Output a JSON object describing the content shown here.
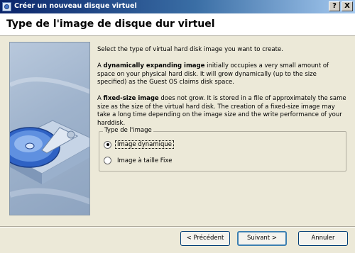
{
  "window": {
    "title": "Créer un nouveau disque virtuel",
    "help_label": "?",
    "close_label": "X"
  },
  "header": {
    "title": "Type de l'image de disque dur virtuel"
  },
  "content": {
    "intro": "Select the type of virtual hard disk image you want to create.",
    "dynamic_bold": "dynamically expanding image",
    "dynamic_prefix": "A ",
    "dynamic_text": " initially occupies a very small amount of space on your physical hard disk. It will grow dynamically (up to the size specified) as the Guest OS claims disk space.",
    "fixed_prefix": "A ",
    "fixed_bold": "fixed-size image",
    "fixed_text": " does not grow. It is stored in a file of approximately the same size as the size of the virtual hard disk. The creation of a fixed-size image may take a long time depending on the image size and the write performance of your harddisk."
  },
  "image_type": {
    "legend": "Type de l'image",
    "options": [
      {
        "label": "Image dynamique",
        "selected": true
      },
      {
        "label": "Image à taille Fixe",
        "selected": false
      }
    ]
  },
  "buttons": {
    "prev": "< Précédent",
    "next": "Suivant >",
    "cancel": "Annuler"
  },
  "colors": {
    "titlebar_start": "#0a246a",
    "titlebar_end": "#a6caf0",
    "dialog_bg": "#ece9d8"
  }
}
